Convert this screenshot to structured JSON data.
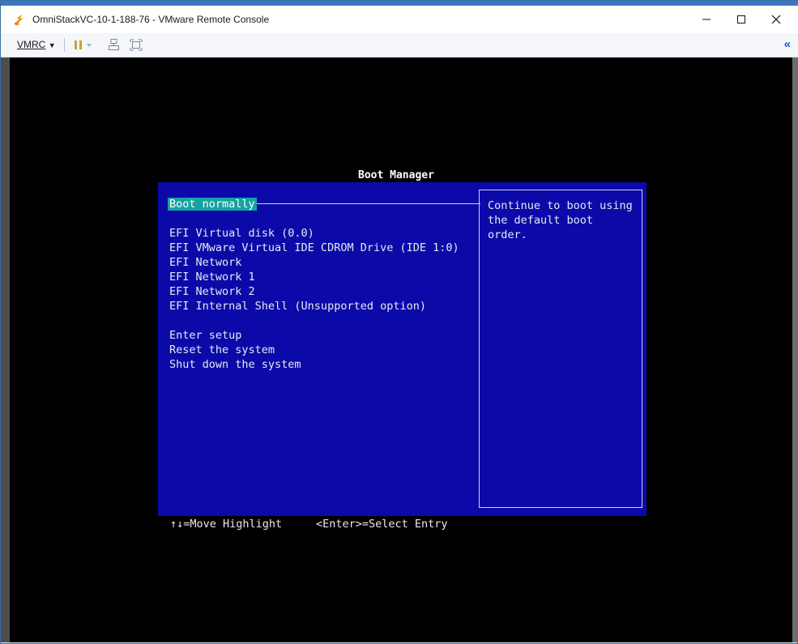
{
  "window": {
    "title": "OmniStackVC-10-1-188-76 - VMware Remote Console",
    "controls": [
      "minimize",
      "maximize",
      "close"
    ]
  },
  "toolbar": {
    "vmrc_label": "VMRC",
    "collapse_glyph": "«"
  },
  "boot_manager": {
    "title": "Boot Manager",
    "selected": "Boot normally",
    "options": [
      "EFI Virtual disk (0.0)",
      "EFI VMware Virtual IDE CDROM Drive (IDE 1:0)",
      "EFI Network",
      "EFI Network 1",
      "EFI Network 2",
      "EFI Internal Shell (Unsupported option)"
    ],
    "actions": [
      "Enter setup",
      "Reset the system",
      "Shut down the system"
    ],
    "help_text": "Continue to boot using the default boot order.",
    "footer_move": "↑↓=Move Highlight",
    "footer_select": "<Enter>=Select Entry"
  },
  "colors": {
    "panel_bg": "#0b0aa8",
    "highlight": "#14a2a2",
    "console_bg": "#000000"
  }
}
